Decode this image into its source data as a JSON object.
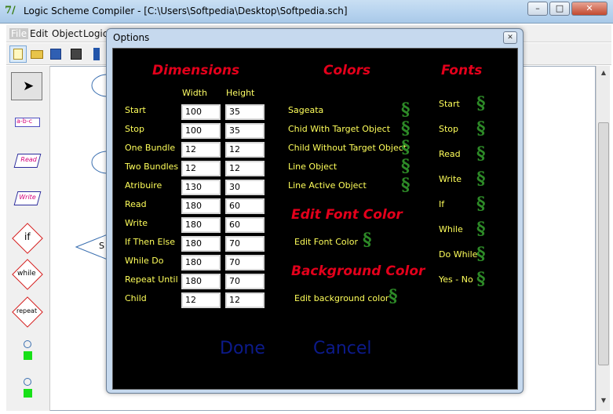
{
  "window": {
    "title": "Logic Scheme Compiler - [C:\\Users\\Softpedia\\Desktop\\Softpedia.sch]",
    "app_icon": "7/",
    "controls": [
      "–",
      "□",
      "✕"
    ]
  },
  "menu": [
    "File",
    "Edit",
    "Object",
    "Logic"
  ],
  "palette": {
    "read_label": "Read",
    "write_label": "Write",
    "if_label": "if",
    "while_label": "while",
    "repeat_label": "repeat",
    "text_tool": "a-b-c"
  },
  "canvas": {
    "shape_text": "S"
  },
  "dialog": {
    "title": "Options",
    "close": "✕",
    "dimensions": {
      "heading": "Dimensions",
      "width_header": "Width",
      "height_header": "Height",
      "rows": [
        {
          "label": "Start",
          "width": "100",
          "height": "35"
        },
        {
          "label": "Stop",
          "width": "100",
          "height": "35"
        },
        {
          "label": "One Bundle",
          "width": "12",
          "height": "12"
        },
        {
          "label": "Two Bundles",
          "width": "12",
          "height": "12"
        },
        {
          "label": "Atribuire",
          "width": "130",
          "height": "30"
        },
        {
          "label": "Read",
          "width": "180",
          "height": "60"
        },
        {
          "label": "Write",
          "width": "180",
          "height": "60"
        },
        {
          "label": "If Then Else",
          "width": "180",
          "height": "70"
        },
        {
          "label": "While Do",
          "width": "180",
          "height": "70"
        },
        {
          "label": "Repeat Until",
          "width": "180",
          "height": "70"
        },
        {
          "label": "Child",
          "width": "12",
          "height": "12"
        }
      ]
    },
    "colors": {
      "heading": "Colors",
      "items": [
        "Sageata",
        "Chid With Target Object",
        "Child Without Target Object",
        "Line Object",
        "Line Active Object"
      ]
    },
    "edit_font_color": {
      "heading": "Edit Font  Color",
      "label": "Edit Font Color"
    },
    "background_color": {
      "heading": "Background Color",
      "label": "Edit background color"
    },
    "fonts": {
      "heading": "Fonts",
      "items": [
        "Start",
        "Stop",
        "Read",
        "Write",
        "If",
        "While",
        "Do While",
        "Yes - No"
      ]
    },
    "picker_symbol": "§",
    "done_label": "Done",
    "cancel_label": "Cancel"
  },
  "colors": {
    "heading_red": "#e3001b",
    "label_yellow": "#ffff5a",
    "symbol_green": "#2d8a27",
    "button_navy": "#0c1a8a"
  }
}
